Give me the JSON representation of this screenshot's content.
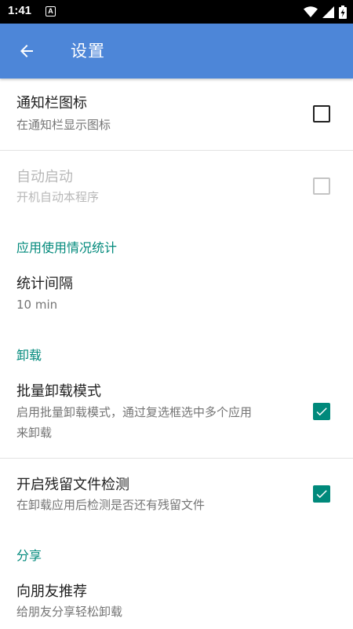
{
  "status_bar": {
    "time": "1:41",
    "badge": "A",
    "icons": [
      "wifi-icon",
      "signal-icon",
      "battery-charging-icon"
    ]
  },
  "app_bar": {
    "title": "设置",
    "back_icon": "arrow-left-icon",
    "background": "#4d86d8"
  },
  "colors": {
    "accent": "#00897b",
    "primary_text": "#212121",
    "secondary_text": "#757575",
    "disabled_text": "#b8b8b8"
  },
  "prefs": {
    "notification_icon": {
      "title": "通知栏图标",
      "summary": "在通知栏显示图标",
      "checked": false,
      "enabled": true
    },
    "auto_start": {
      "title": "自动启动",
      "summary": "开机自动本程序",
      "checked": false,
      "enabled": false
    },
    "stats_interval": {
      "title": "统计间隔",
      "summary": "10 min"
    },
    "batch_uninstall": {
      "title": "批量卸载模式",
      "summary_line1": "启用批量卸载模式，通过复选框选中多个应用",
      "summary_line2": "来卸载",
      "checked": true,
      "enabled": true
    },
    "residual_check": {
      "title": "开启残留文件检测",
      "summary": "在卸载应用后检测是否还有残留文件",
      "checked": true,
      "enabled": true
    },
    "recommend": {
      "title": "向朋友推荐",
      "summary": "给朋友分享轻松卸载"
    }
  },
  "categories": {
    "usage_stats": "应用使用情况统计",
    "uninstall": "卸载",
    "share": "分享"
  }
}
